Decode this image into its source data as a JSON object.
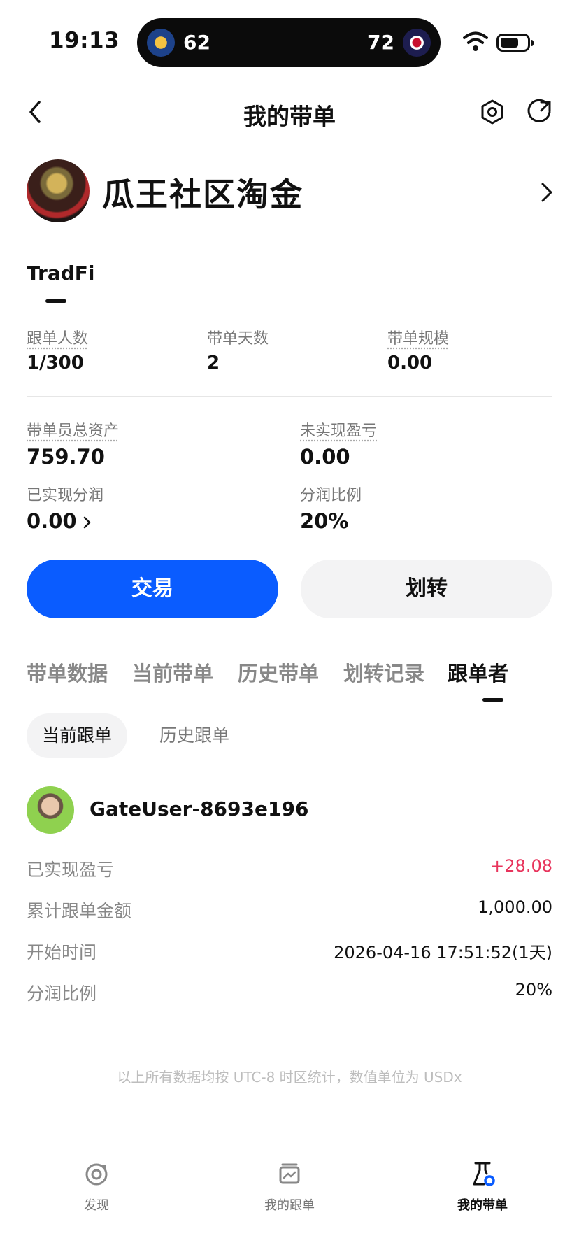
{
  "status_bar": {
    "time": "19:13",
    "live_score": {
      "home_score": "62",
      "away_score": "72"
    }
  },
  "nav": {
    "title": "我的带单",
    "icons": [
      "back-icon",
      "settings-icon",
      "share-icon"
    ]
  },
  "profile": {
    "name": "瓜王社区淘金"
  },
  "category_tab": "TradFi",
  "stats": {
    "followers_label": "跟单人数",
    "followers_value": "1/300",
    "days_label": "带单天数",
    "days_value": "2",
    "scale_label": "带单规模",
    "scale_value": "0.00",
    "total_assets_label": "带单员总资产",
    "total_assets_value": "759.70",
    "unrealized_pnl_label": "未实现盈亏",
    "unrealized_pnl_value": "0.00",
    "realized_share_label": "已实现分润",
    "realized_share_value": "0.00",
    "share_ratio_label": "分润比例",
    "share_ratio_value": "20%"
  },
  "actions": {
    "trade_label": "交易",
    "transfer_label": "划转"
  },
  "section_tabs": [
    {
      "label": "带单数据",
      "active": false
    },
    {
      "label": "当前带单",
      "active": false
    },
    {
      "label": "历史带单",
      "active": false
    },
    {
      "label": "划转记录",
      "active": false
    },
    {
      "label": "跟单者",
      "active": true
    }
  ],
  "sub_tabs": [
    {
      "label": "当前跟单",
      "active": true
    },
    {
      "label": "历史跟单",
      "active": false
    }
  ],
  "follower": {
    "name": "GateUser-8693e196",
    "rows": [
      {
        "label": "已实现盈亏",
        "value": "+28.08"
      },
      {
        "label": "累计跟单金额",
        "value": "1,000.00"
      },
      {
        "label": "开始时间",
        "value": "2026-04-16 17:51:52(1天)"
      },
      {
        "label": "分润比例",
        "value": "20%"
      }
    ]
  },
  "footnote": "以上所有数据均按 UTC-8 时区统计，数值单位为 USDx",
  "bottom_nav": [
    {
      "label": "发现",
      "icon": "discover-icon",
      "active": false
    },
    {
      "label": "我的跟单",
      "icon": "my-follow-icon",
      "active": false
    },
    {
      "label": "我的带单",
      "icon": "my-lead-icon",
      "active": true
    }
  ],
  "colors": {
    "accent": "#0a5cff",
    "positive": "#e8345c",
    "muted": "#888888"
  }
}
